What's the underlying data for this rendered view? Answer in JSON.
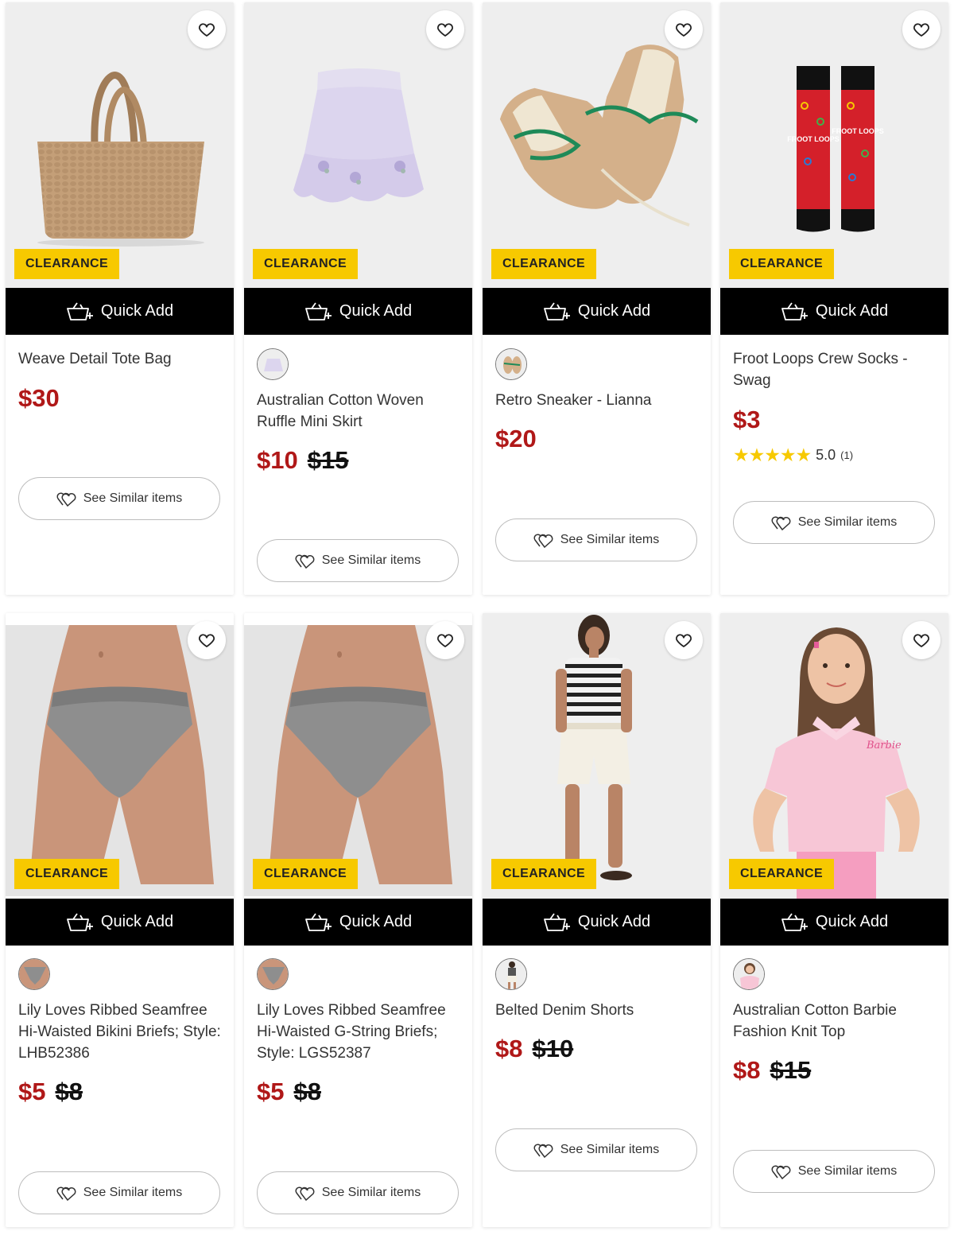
{
  "common": {
    "badge": "CLEARANCE",
    "quick_add": "Quick Add",
    "see_similar": "See Similar items"
  },
  "products": [
    {
      "title": "Weave Detail Tote Bag",
      "price": "$30",
      "was": ""
    },
    {
      "title": "Australian Cotton Woven Ruffle Mini Skirt",
      "price": "$10",
      "was": "$15"
    },
    {
      "title": "Retro Sneaker - Lianna",
      "price": "$20",
      "was": ""
    },
    {
      "title": "Froot Loops Crew Socks - Swag",
      "price": "$3",
      "was": "",
      "rating_value": "5.0",
      "rating_count": "(1)",
      "stars": 5,
      "sock_text": "FROOT LOOPS"
    },
    {
      "title": "Lily Loves Ribbed Seamfree Hi-Waisted Bikini Briefs; Style: LHB52386",
      "price": "$5",
      "was": "$8"
    },
    {
      "title": "Lily Loves Ribbed Seamfree Hi-Waisted G-String Briefs; Style: LGS52387",
      "price": "$5",
      "was": "$8"
    },
    {
      "title": "Belted Denim Shorts",
      "price": "$8",
      "was": "$10"
    },
    {
      "title": "Australian Cotton Barbie Fashion Knit Top",
      "price": "$8",
      "was": "$15",
      "shirt_text": "Barbie"
    }
  ],
  "colors": {
    "sale_price": "#b01818",
    "badge_bg": "#f7c900",
    "quick_add_bg": "#000000",
    "star": "#f7c900"
  },
  "icons": {
    "favorite": "heart-icon",
    "quick_add": "basket-plus-icon",
    "see_similar": "double-heart-icon",
    "rating": "star-icon"
  }
}
